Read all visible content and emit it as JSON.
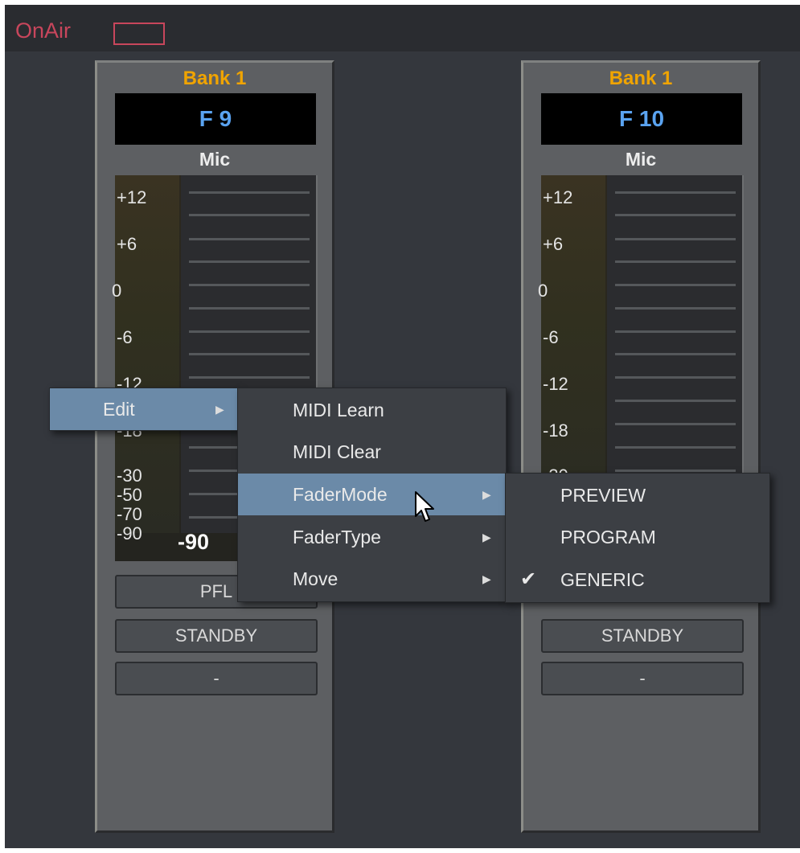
{
  "header": {
    "title": "OnAir"
  },
  "strips": [
    {
      "bank": "Bank 1",
      "fader_name": "F 9",
      "source": "Mic",
      "meter_labels": [
        "+12",
        "+6",
        "0",
        "-6",
        "-12",
        "-18",
        "-30",
        "-50",
        "-70",
        "-90"
      ],
      "level": "-90",
      "buttons": [
        "PFL",
        "STANDBY",
        "-"
      ]
    },
    {
      "bank": "Bank 1",
      "fader_name": "F 10",
      "source": "Mic",
      "meter_labels": [
        "+12",
        "+6",
        "0",
        "-6",
        "-12",
        "-18",
        "-30"
      ],
      "buttons": [
        "STANDBY",
        "-"
      ]
    }
  ],
  "context_menu": {
    "root": {
      "label": "Edit"
    },
    "edit_submenu": [
      "MIDI Learn",
      "MIDI Clear",
      "FaderMode",
      "FaderType",
      "Move"
    ],
    "fadermode_submenu": [
      "PREVIEW",
      "PROGRAM",
      "GENERIC"
    ],
    "checked": "GENERIC"
  },
  "colors": {
    "onair": "#c8465c",
    "bank": "#f0a400",
    "fader_name": "#5aa3f0",
    "menu_highlight": "#6b8aa8"
  }
}
